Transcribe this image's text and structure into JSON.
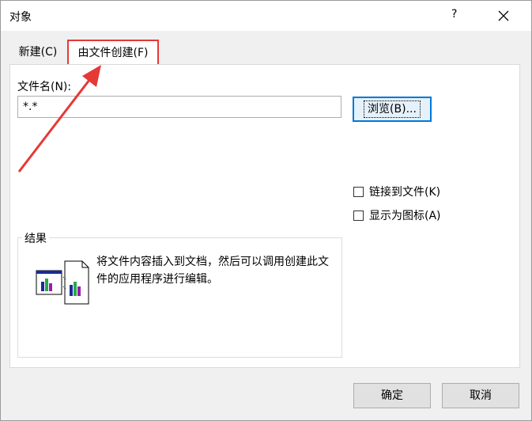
{
  "window": {
    "title": "对象",
    "help_label": "?"
  },
  "tabs": [
    {
      "label": "新建(C)",
      "selected": false
    },
    {
      "label": "由文件创建(F)",
      "selected": true
    }
  ],
  "file_section": {
    "filename_label": "文件名(N):",
    "filename_value": "*.*",
    "browse_label": "浏览(B)..."
  },
  "options": {
    "link_label": "链接到文件(K)",
    "link_checked": false,
    "icon_label": "显示为图标(A)",
    "icon_checked": false
  },
  "result": {
    "legend": "结果",
    "description": "将文件内容插入到文档，然后可以调用创建此文件的应用程序进行编辑。"
  },
  "footer": {
    "ok_label": "确定",
    "cancel_label": "取消"
  },
  "colors": {
    "highlight": "#e53935",
    "focus": "#0078d7"
  }
}
